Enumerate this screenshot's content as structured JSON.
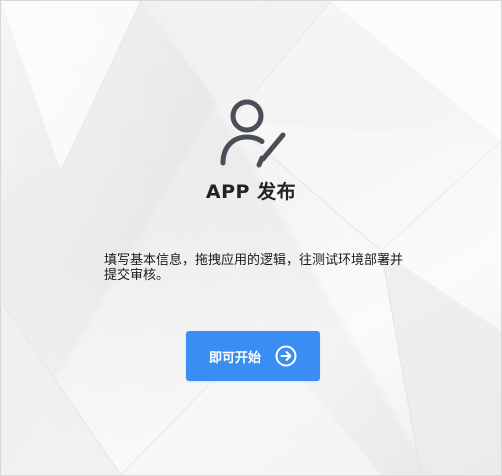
{
  "card": {
    "icon": "user-edit-icon",
    "title": "APP 发布",
    "description": "填写基本信息，拖拽应用的逻辑，往测试环境部署并提交审核。"
  },
  "action": {
    "start_label": "即可开始",
    "icon": "arrow-right-circle-icon"
  },
  "colors": {
    "accent": "#3a8ef3",
    "icon": "#4a4f57"
  }
}
